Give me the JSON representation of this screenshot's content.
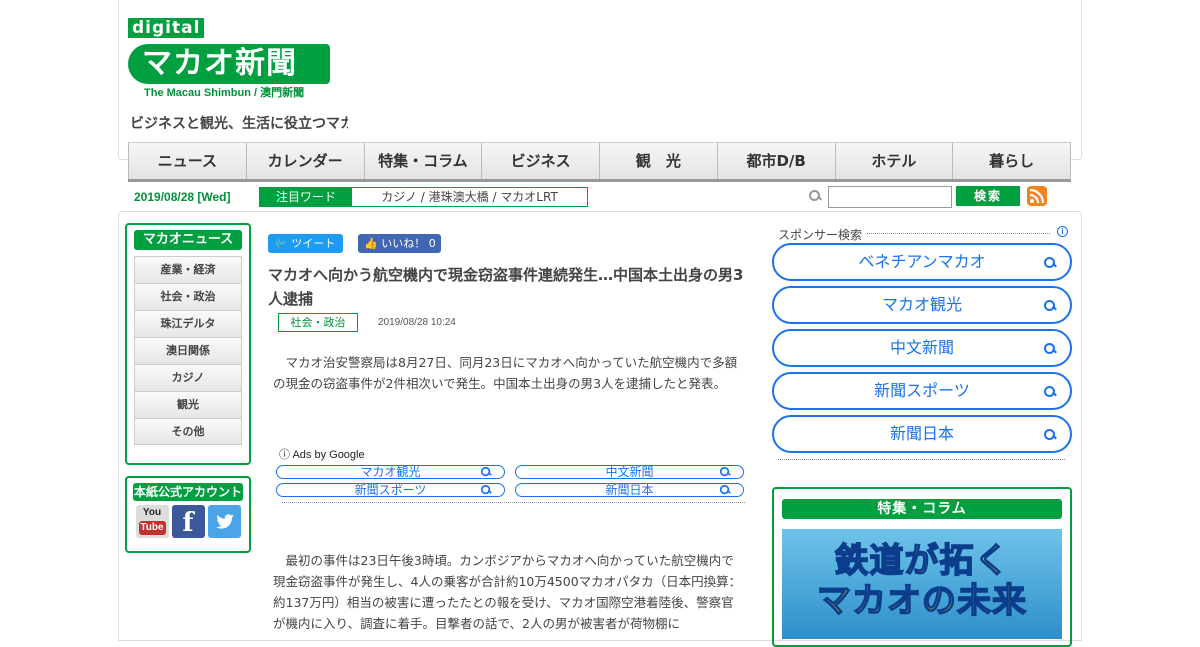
{
  "header": {
    "logo_digital": "digital",
    "logo_main": "マカオ新聞",
    "logo_sub": "The Macau Shimbun / 澳門新聞",
    "tagline": "ビジネスと観光、生活に役立つマカ"
  },
  "nav": {
    "items": [
      "ニュース",
      "カレンダー",
      "特集・コラム",
      "ビジネス",
      "観　光",
      "都市D/B",
      "ホテル",
      "暮らし"
    ]
  },
  "infobar": {
    "date": "2019/08/28 [Wed]",
    "hotword_label": "注目ワード",
    "hotword_value": "カジノ / 港珠澳大橋 / マカオLRT",
    "search_value": "",
    "search_button": "検索"
  },
  "left_sidebar": {
    "title": "マカオニュース",
    "items": [
      "産業・経済",
      "社会・政治",
      "珠江デルタ",
      "澳日関係",
      "カジノ",
      "観光",
      "その他"
    ],
    "social_title": "本紙公式アカウント",
    "youtube_top": "You",
    "youtube_bottom": "Tube",
    "facebook": "f"
  },
  "article": {
    "tweet_label": "ツイート",
    "like_label": "いいね！ 0",
    "headline": "マカオへ向かう航空機内で現金窃盗事件連続発生…中国本土出身の男3人逮捕",
    "category": "社会・政治",
    "timestamp": "2019/08/28 10:24",
    "paragraph1": "マカオ治安警察局は8月27日、同月23日にマカオへ向かっていた航空機内で多額の現金の窃盗事件が2件相次いで発生。中国本土出身の男3人を逮捕したと発表。",
    "ads_label": "ⓘ Ads by Google",
    "ad_links": [
      "マカオ観光",
      "中文新聞",
      "新聞スポーツ",
      "新聞日本"
    ],
    "paragraph2": "最初の事件は23日午後3時頃。カンボジアからマカオへ向かっていた航空機内で現金窃盗事件が発生し、4人の乗客が合計約10万4500マカオパタカ（日本円換算：約137万円）相当の被害に遭ったたとの報を受け、マカオ国際空港着陸後、警察官が機内に入り、調査に着手。目撃者の話で、2人の男が被害者が荷物棚に"
  },
  "right_sidebar": {
    "sponsor_label": "スポンサー検索",
    "links": [
      "ベネチアンマカオ",
      "マカオ観光",
      "中文新聞",
      "新聞スポーツ",
      "新聞日本"
    ],
    "feature_title": "特集・コラム",
    "feature_line1": "鉄道が拓く",
    "feature_line2": "マカオの未来"
  },
  "colors": {
    "brand_green": "#00a040",
    "link_blue": "#1a73e8",
    "rss_orange": "#f58220"
  }
}
